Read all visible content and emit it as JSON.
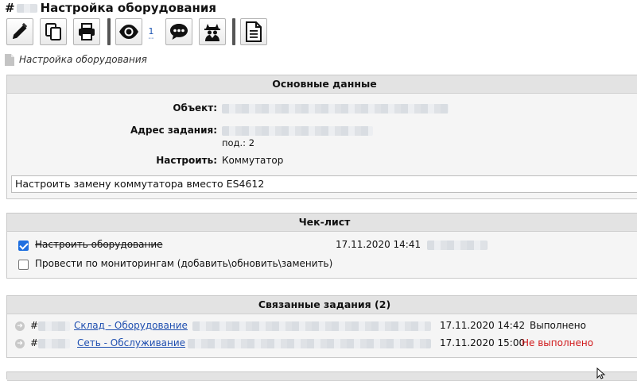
{
  "header": {
    "hash": "#",
    "title": "Настройка оборудования"
  },
  "toolbar": {
    "buttons": [
      {
        "icon": "pencil-icon"
      },
      {
        "icon": "copy-icon"
      },
      {
        "icon": "print-icon"
      },
      {
        "icon": "eye-icon"
      },
      {
        "icon": "comment-icon"
      },
      {
        "icon": "spy-icon"
      },
      {
        "icon": "document-icon"
      }
    ],
    "watch_count": "1",
    "watch_dash": "--"
  },
  "breadcrumb": {
    "label": "Настройка оборудования"
  },
  "main_panel": {
    "heading": "Основные данные",
    "object_label": "Объект:",
    "address_label": "Адрес задания:",
    "entrance": "под.: 2",
    "configure_label": "Настроить:",
    "configure_value": "Коммутатор",
    "task_text": "Настроить замену коммутатора вместо ES4612"
  },
  "checklist": {
    "heading": "Чек-лист",
    "items": [
      {
        "text": "Настроить оборудование",
        "done": true,
        "datetime": "17.11.2020 14:41"
      },
      {
        "text": "Провести по мониторингам (добавить\\обновить\\заменить)",
        "done": false
      }
    ]
  },
  "related": {
    "heading": "Связанные задания (2)",
    "rows": [
      {
        "hash": "#",
        "link": "Склад - Оборудование",
        "datetime": "17.11.2020 14:42",
        "status": "Выполнено",
        "status_color": "#111111"
      },
      {
        "hash": "#",
        "link": "Сеть - Обслуживание",
        "datetime": "17.11.2020 15:00",
        "status": "Не выполнено",
        "status_color": "#d0191b"
      }
    ]
  },
  "colors": {
    "panel_header": "#e3e3e3",
    "panel_body": "#f5f5f5",
    "link": "#1f4fb0",
    "checkbox": "#1f6fe0",
    "error": "#d0191b"
  }
}
